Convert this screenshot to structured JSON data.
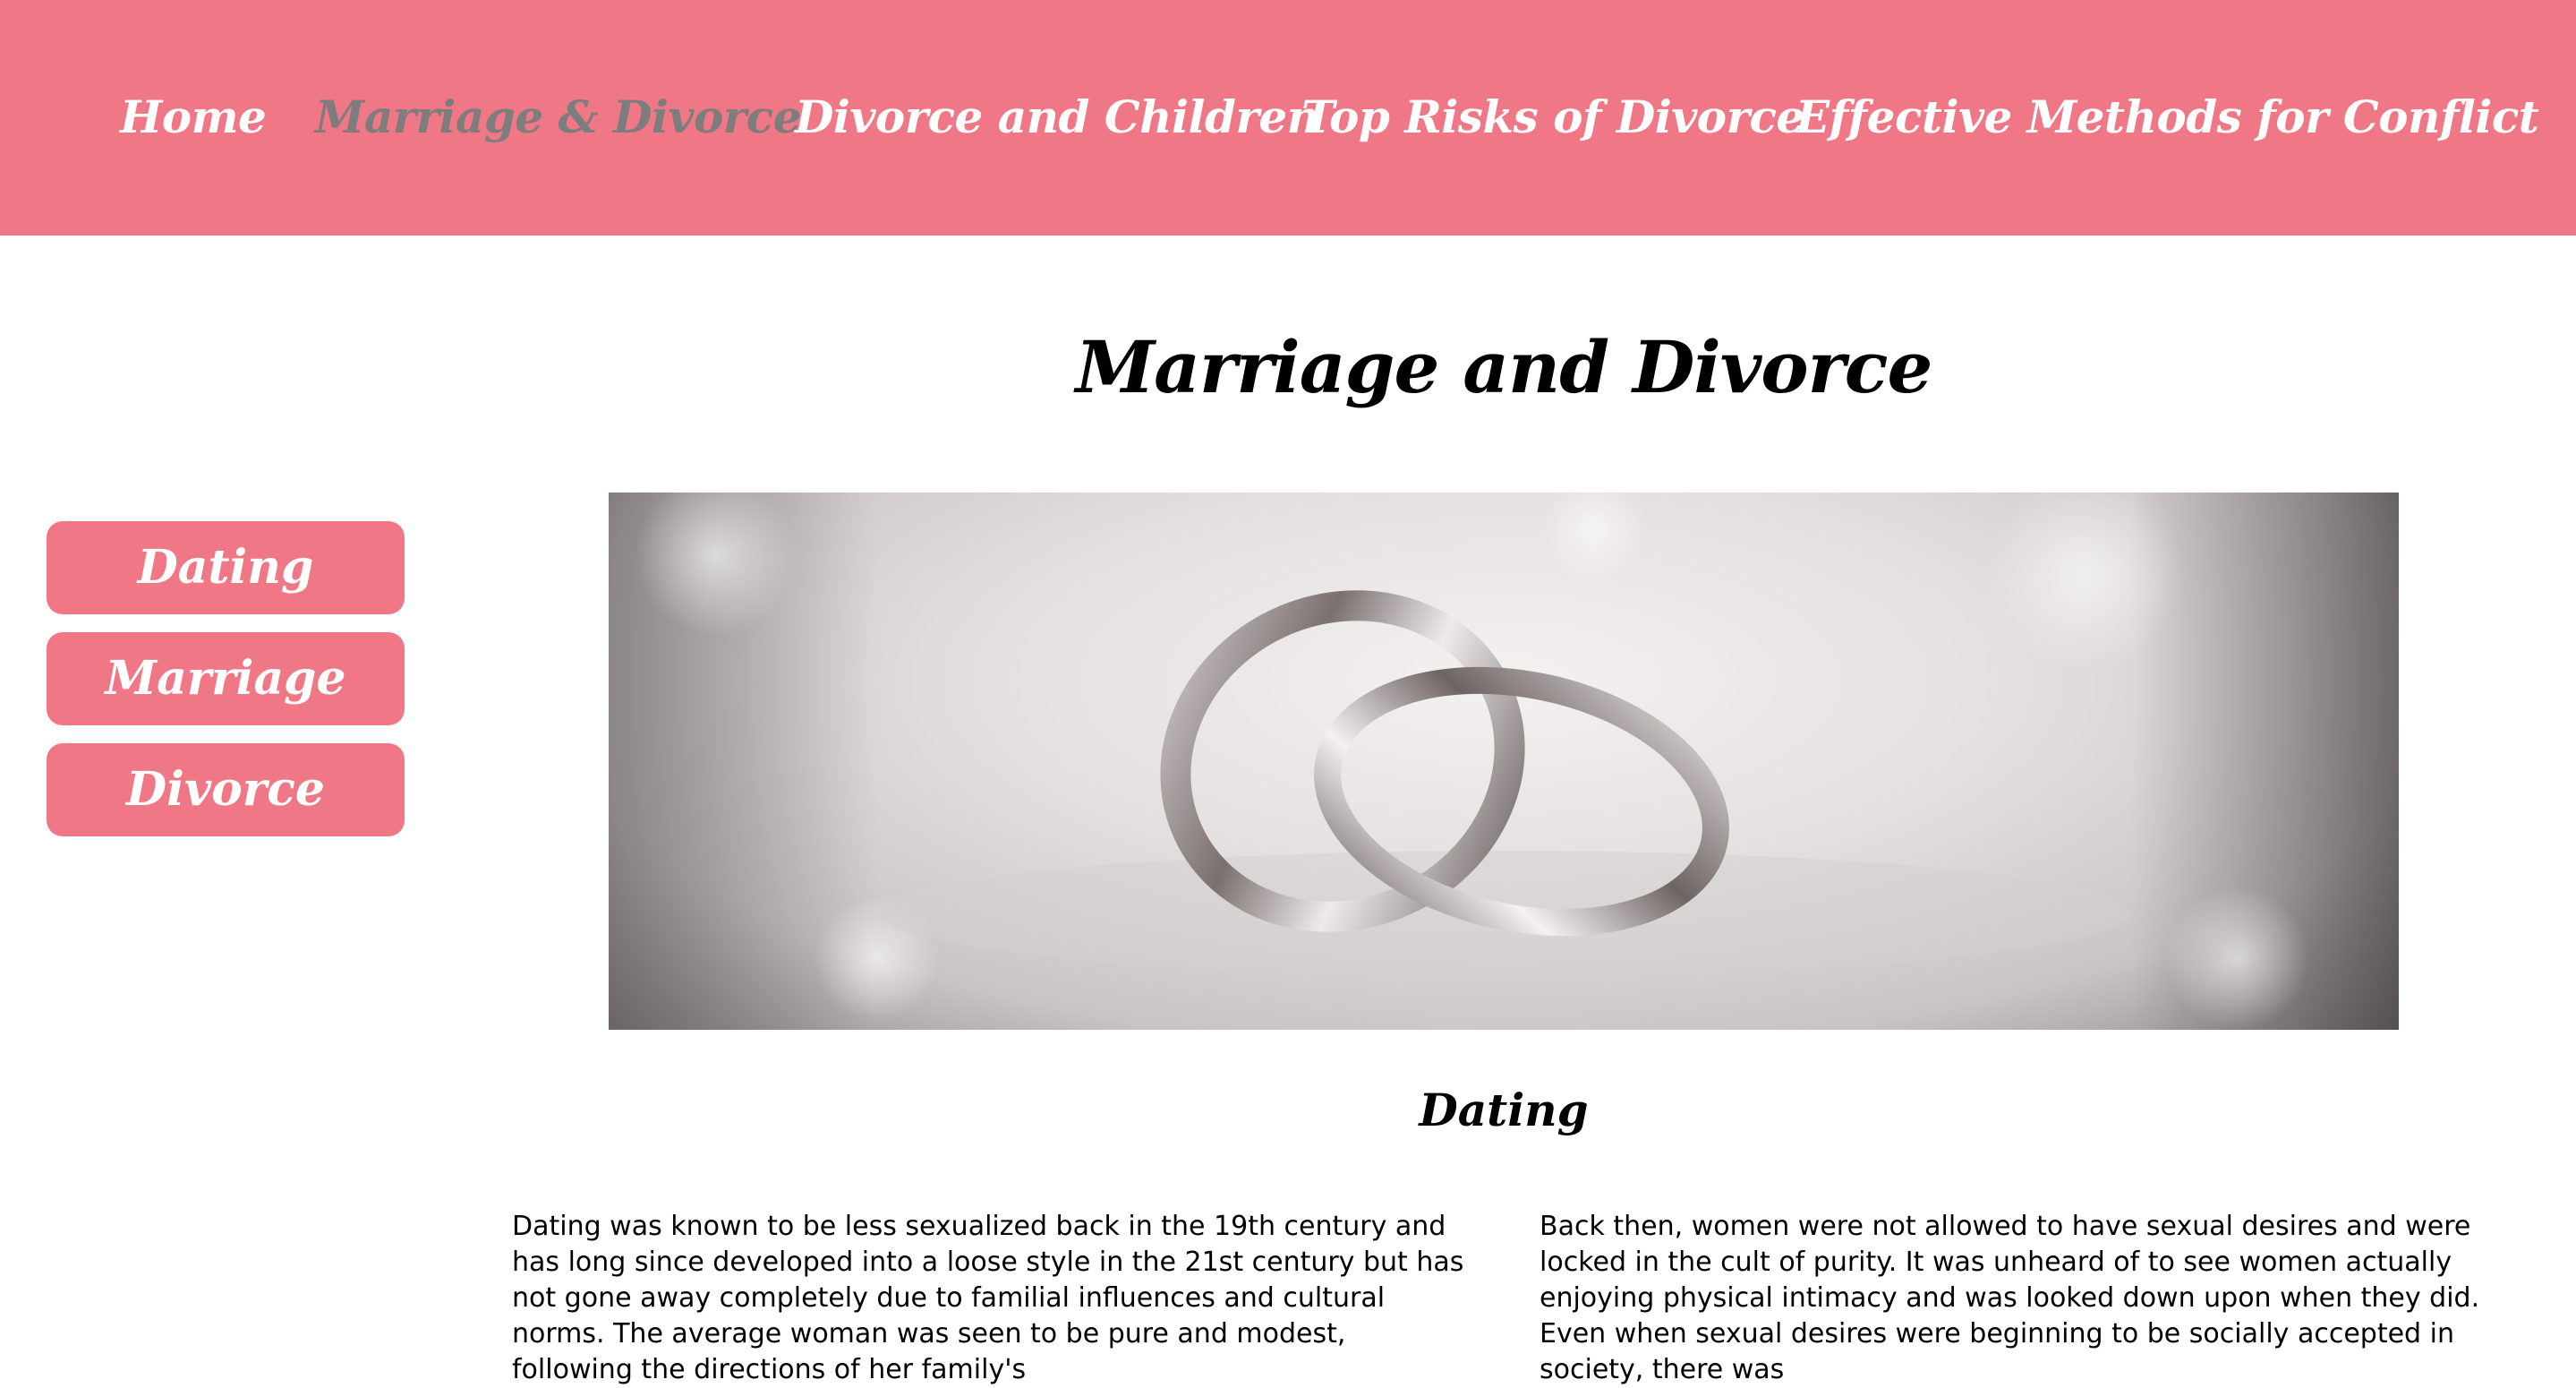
{
  "nav": {
    "items": [
      {
        "label": "Home",
        "active": false
      },
      {
        "label": "Marriage & Divorce",
        "active": true
      },
      {
        "label": "Divorce and Children",
        "active": false
      },
      {
        "label": "Top Risks of Divorce",
        "active": false
      },
      {
        "label": "Effective Methods for Conflict",
        "active": false
      }
    ]
  },
  "page": {
    "title": "Marriage and Divorce"
  },
  "sidebar": {
    "items": [
      {
        "label": "Dating"
      },
      {
        "label": "Marriage"
      },
      {
        "label": "Divorce"
      }
    ]
  },
  "hero": {
    "subject": "wedding-rings"
  },
  "section": {
    "heading": "Dating",
    "paragraph_left": "Dating was known to be less sexualized back in the 19th century and has long since developed into a loose style in the 21st century but has not gone away completely due to familial influences and cultural norms. The average woman was seen to be pure and modest, following the directions of her family's",
    "paragraph_right": "Back then, women were not allowed to have sexual desires and were locked in the cult of purity. It was unheard of to see women actually enjoying physical intimacy and was looked down upon when they did. Even when sexual desires were beginning to be socially accepted in society, there was"
  },
  "colors": {
    "accent": "#f07786",
    "active_nav": "#7d7d7d",
    "text": "#000000",
    "nav_text": "#ffffff"
  }
}
